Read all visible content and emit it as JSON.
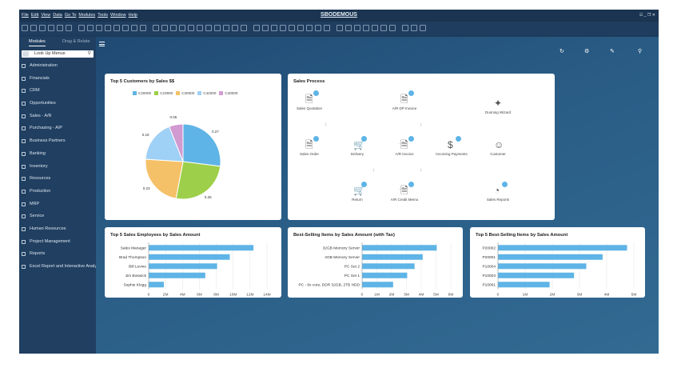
{
  "app": {
    "title": "SBODEMOUS",
    "menu": [
      "File",
      "Edit",
      "View",
      "Data",
      "Go To",
      "Modules",
      "Tools",
      "Window",
      "Help"
    ],
    "window_controls": "☷ _ ❐ ✕"
  },
  "sidebar": {
    "tabs": {
      "active": "Modules",
      "other": "Drag & Relate"
    },
    "search_placeholder": "Look Up Menus",
    "items": [
      {
        "label": "Administration",
        "icon": "gear-icon"
      },
      {
        "label": "Financials",
        "icon": "chart-icon"
      },
      {
        "label": "CRM",
        "icon": "crm-icon"
      },
      {
        "label": "Opportunities",
        "icon": "opportunity-icon"
      },
      {
        "label": "Sales - A/R",
        "icon": "sales-icon"
      },
      {
        "label": "Purchasing - A/P",
        "icon": "cart-icon"
      },
      {
        "label": "Business Partners",
        "icon": "partners-icon"
      },
      {
        "label": "Banking",
        "icon": "bank-icon"
      },
      {
        "label": "Inventory",
        "icon": "inventory-icon"
      },
      {
        "label": "Resources",
        "icon": "resources-icon"
      },
      {
        "label": "Production",
        "icon": "production-icon"
      },
      {
        "label": "MRP",
        "icon": "mrp-icon"
      },
      {
        "label": "Service",
        "icon": "service-icon"
      },
      {
        "label": "Human Resources",
        "icon": "person-icon"
      },
      {
        "label": "Project Management",
        "icon": "project-icon"
      },
      {
        "label": "Reports",
        "icon": "report-icon"
      },
      {
        "label": "Excel Report and Interactive Analysis",
        "icon": "excel-icon"
      }
    ]
  },
  "topbar": {
    "icons": [
      "refresh-icon",
      "settings-icon",
      "edit-icon",
      "search-icon"
    ]
  },
  "customers_chart": {
    "title": "Top 5 Customers by Sales $$",
    "legend": [
      {
        "label": "C20000",
        "color": "#5eb4e6"
      },
      {
        "label": "C23900",
        "color": "#9ecf4a"
      },
      {
        "label": "C30000",
        "color": "#f5c168"
      },
      {
        "label": "C42000",
        "color": "#9fd0f5"
      },
      {
        "label": "C40000",
        "color": "#d19bd2"
      }
    ],
    "slices": [
      {
        "label": "0.27",
        "value": 0.27,
        "color": "#5eb4e6"
      },
      {
        "label": "0.26",
        "value": 0.26,
        "color": "#9ecf4a"
      },
      {
        "label": "0.23",
        "value": 0.23,
        "color": "#f5c168"
      },
      {
        "label": "0.18",
        "value": 0.18,
        "color": "#9fd0f5"
      },
      {
        "label": "0.06",
        "value": 0.06,
        "color": "#d19bd2"
      }
    ]
  },
  "sales_process": {
    "title": "Sales Process",
    "nodes": [
      {
        "label": "Sales Quotation",
        "icon": "document-icon"
      },
      {
        "label": "A/R DP Invoice",
        "icon": "invoice-icon"
      },
      {
        "label": "Dunning Wizard",
        "icon": "dunning-icon"
      },
      {
        "label": "Sales Order",
        "icon": "document-icon"
      },
      {
        "label": "Delivery",
        "icon": "cart-icon"
      },
      {
        "label": "A/R Invoice",
        "icon": "invoice-icon"
      },
      {
        "label": "Incoming Payments",
        "icon": "payment-icon"
      },
      {
        "label": "Customer",
        "icon": "customer-icon"
      },
      {
        "label": "Return",
        "icon": "cart-icon"
      },
      {
        "label": "A/R Credit Memo",
        "icon": "memo-icon"
      },
      {
        "label": "Sales Reports",
        "icon": "report-icon"
      }
    ]
  },
  "employees_chart": {
    "title": "Top 5 Sales Employees by Sales Amount",
    "categories": [
      "Sales Manager",
      "Brad Thompson",
      "Bill Levine",
      "Jim Boswick",
      "Sophie Klogg"
    ],
    "values": [
      12.4,
      9.6,
      8.1,
      6.7,
      1.8
    ],
    "ticks": [
      "0",
      "2M",
      "4M",
      "6M",
      "8M",
      "10M",
      "12M",
      "14M"
    ],
    "xmax": 14,
    "color": "#5eb4e6"
  },
  "items_tax_chart": {
    "title": "Best-Selling Items by Sales Amount (with Tax)",
    "categories": [
      "32GB Memory Server",
      "4GB Memory Server",
      "PC Set 2",
      "PC Set 1",
      "PC - 8x core, DDR 32GB, 2TB HDD"
    ],
    "values": [
      5.05,
      4.1,
      3.55,
      3.05,
      2.1
    ],
    "ticks": [
      "0",
      "1M",
      "2M",
      "3M",
      "4M",
      "5M",
      "6M"
    ],
    "xmax": 6,
    "color": "#5eb4e6"
  },
  "items_chart": {
    "title": "Top 5 Best-Selling Items by Sales Amount",
    "categories": [
      "P20002",
      "P20001",
      "P10004",
      "P10003",
      "P10001"
    ],
    "values": [
      4.75,
      3.85,
      3.25,
      2.8,
      1.9
    ],
    "ticks": [
      "0",
      "1M",
      "2M",
      "3M",
      "4M",
      "5M"
    ],
    "xmax": 5,
    "color": "#5eb4e6"
  },
  "chart_data": [
    {
      "type": "pie",
      "title": "Top 5 Customers by Sales $$",
      "categories": [
        "C20000",
        "C23900",
        "C30000",
        "C42000",
        "C40000"
      ],
      "values": [
        0.27,
        0.26,
        0.23,
        0.18,
        0.06
      ]
    },
    {
      "type": "bar",
      "title": "Top 5 Sales Employees by Sales Amount",
      "categories": [
        "Sales Manager",
        "Brad Thompson",
        "Bill Levine",
        "Jim Boswick",
        "Sophie Klogg"
      ],
      "values": [
        12.4,
        9.6,
        8.1,
        6.7,
        1.8
      ],
      "xlim": [
        0,
        14
      ]
    },
    {
      "type": "bar",
      "title": "Best-Selling Items by Sales Amount (with Tax)",
      "categories": [
        "32GB Memory Server",
        "4GB Memory Server",
        "PC Set 2",
        "PC Set 1",
        "PC - 8x core, DDR 32GB, 2TB HDD"
      ],
      "values": [
        5.05,
        4.1,
        3.55,
        3.05,
        2.1
      ],
      "xlim": [
        0,
        6
      ]
    },
    {
      "type": "bar",
      "title": "Top 5 Best-Selling Items by Sales Amount",
      "categories": [
        "P20002",
        "P20001",
        "P10004",
        "P10003",
        "P10001"
      ],
      "values": [
        4.75,
        3.85,
        3.25,
        2.8,
        1.9
      ],
      "xlim": [
        0,
        5
      ]
    }
  ]
}
